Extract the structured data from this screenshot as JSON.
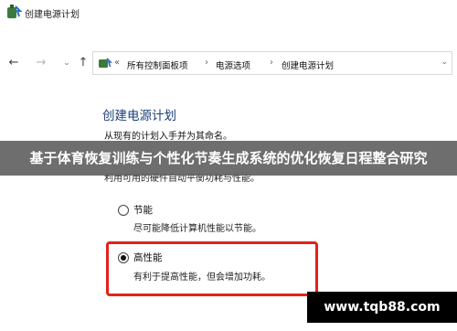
{
  "window": {
    "title": "创建电源计划"
  },
  "navigation": {
    "breadcrumbs": [
      {
        "label": "所有控制面板项"
      },
      {
        "label": "电源选项"
      },
      {
        "label": "创建电源计划"
      }
    ],
    "overflow_glyph": "«"
  },
  "content": {
    "title": "创建电源计划",
    "description": "从现有的计划入手并为其命名。",
    "partially_hidden_text": "利用可用的硬件自动平衡功耗与性能。",
    "options": [
      {
        "label": "节能",
        "description": "尽可能降低计算机性能以节能。",
        "selected": false
      },
      {
        "label": "高性能",
        "description": "有利于提高性能，但会增加功耗。",
        "selected": true
      }
    ]
  },
  "overlay": {
    "banner_text": "基于体育恢复训练与个性化节奏生成系统的优化恢复日程整合研究",
    "watermark_text": "www.tqb88.com"
  },
  "colors": {
    "title_blue": "#1b3e7a",
    "highlight_red": "#e2231a",
    "banner_gray": "#646464"
  }
}
